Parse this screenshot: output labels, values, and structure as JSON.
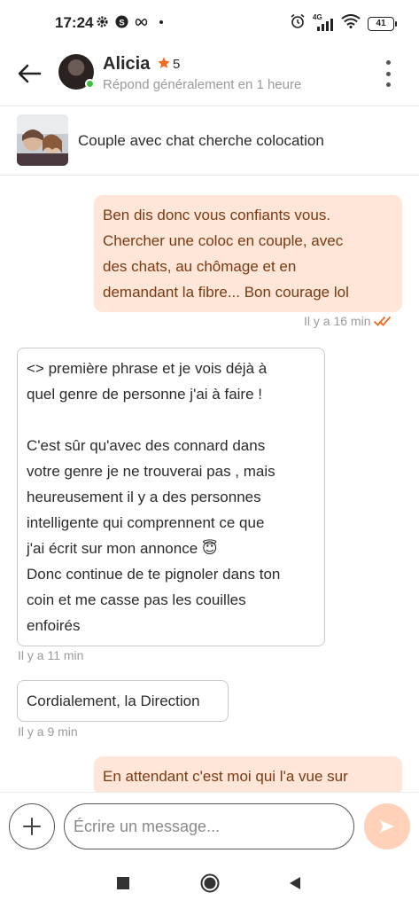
{
  "status_bar": {
    "time": "17:24",
    "battery": "41",
    "network": "4G",
    "icons": [
      "gear-icon",
      "shazam-icon",
      "infinity-icon",
      "dot-icon",
      "alarm-icon",
      "signal-icon",
      "wifi-icon",
      "battery-icon"
    ]
  },
  "header": {
    "name": "Alicia",
    "rating": "5",
    "subtitle": "Répond généralement en 1 heure",
    "online": true
  },
  "listing": {
    "title": "Couple avec chat cherche colocation"
  },
  "messages": [
    {
      "direction": "out",
      "lines": [
        "Ben dis donc vous confiants vous.",
        "Chercher une coloc en couple, avec",
        "des chats, au chômage et en",
        "demandant la fibre... Bon courage lol"
      ],
      "time": "Il y a 16 min",
      "read": true
    },
    {
      "direction": "in",
      "lines": [
        "<> première phrase et je vois déjà à",
        "quel genre de personne j'ai à faire !",
        "",
        "C'est sûr qu'avec des connard dans",
        "votre genre je ne trouverai pas , mais",
        "heureusement il y a des personnes",
        "intelligente qui comprennent ce que",
        "j'ai écrit sur mon annonce 😇",
        "Donc continue de te pignoler dans ton",
        "coin et me casse pas les couilles",
        "enfoirés"
      ],
      "time": "Il y a 11 min"
    },
    {
      "direction": "in",
      "lines": [
        "Cordialement, la Direction"
      ],
      "time": "Il y a 9 min"
    },
    {
      "direction": "out",
      "lines": [
        "En attendant c'est moi qui l'a vue sur"
      ]
    }
  ],
  "composer": {
    "placeholder": "Écrire un message..."
  },
  "colors": {
    "accent": "#f26a1b",
    "outgoing_bubble": "#ffe6d9",
    "outgoing_text": "#7a3a10",
    "send_button": "#ffd1b8",
    "online": "#3fbf3f"
  }
}
